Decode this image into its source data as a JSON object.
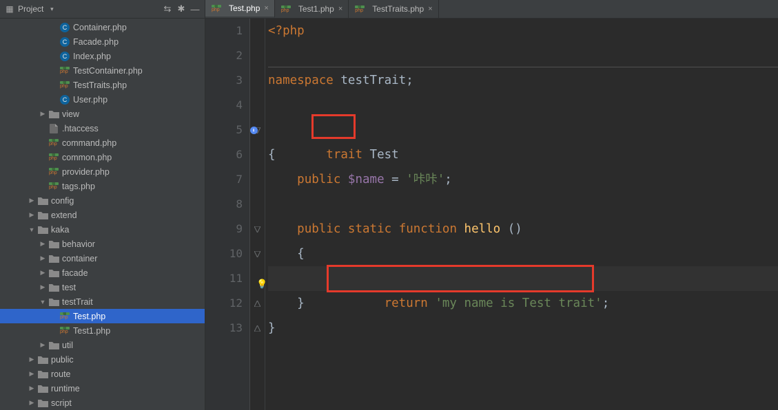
{
  "sidebar": {
    "title": "Project",
    "tree": [
      {
        "depth": 4,
        "icon": "php-class",
        "label": "Container.php",
        "arrow": "none"
      },
      {
        "depth": 4,
        "icon": "php-class",
        "label": "Facade.php",
        "arrow": "none"
      },
      {
        "depth": 4,
        "icon": "php-class",
        "label": "Index.php",
        "arrow": "none"
      },
      {
        "depth": 4,
        "icon": "php-ns",
        "label": "TestContainer.php",
        "arrow": "none"
      },
      {
        "depth": 4,
        "icon": "php-ns",
        "label": "TestTraits.php",
        "arrow": "none"
      },
      {
        "depth": 4,
        "icon": "php-class",
        "label": "User.php",
        "arrow": "none"
      },
      {
        "depth": 3,
        "icon": "folder",
        "label": "view",
        "arrow": "right"
      },
      {
        "depth": 3,
        "icon": "file",
        "label": ".htaccess",
        "arrow": "none"
      },
      {
        "depth": 3,
        "icon": "php-ns",
        "label": "command.php",
        "arrow": "none"
      },
      {
        "depth": 3,
        "icon": "php-ns",
        "label": "common.php",
        "arrow": "none"
      },
      {
        "depth": 3,
        "icon": "php-ns",
        "label": "provider.php",
        "arrow": "none"
      },
      {
        "depth": 3,
        "icon": "php-ns",
        "label": "tags.php",
        "arrow": "none"
      },
      {
        "depth": 2,
        "icon": "folder",
        "label": "config",
        "arrow": "right"
      },
      {
        "depth": 2,
        "icon": "folder",
        "label": "extend",
        "arrow": "right"
      },
      {
        "depth": 2,
        "icon": "folder",
        "label": "kaka",
        "arrow": "down"
      },
      {
        "depth": 3,
        "icon": "folder",
        "label": "behavior",
        "arrow": "right"
      },
      {
        "depth": 3,
        "icon": "folder",
        "label": "container",
        "arrow": "right"
      },
      {
        "depth": 3,
        "icon": "folder",
        "label": "facade",
        "arrow": "right"
      },
      {
        "depth": 3,
        "icon": "folder",
        "label": "test",
        "arrow": "right"
      },
      {
        "depth": 3,
        "icon": "folder",
        "label": "testTrait",
        "arrow": "down"
      },
      {
        "depth": 4,
        "icon": "php-ns",
        "label": "Test.php",
        "arrow": "none",
        "selected": true
      },
      {
        "depth": 4,
        "icon": "php-ns",
        "label": "Test1.php",
        "arrow": "none"
      },
      {
        "depth": 3,
        "icon": "folder",
        "label": "util",
        "arrow": "right"
      },
      {
        "depth": 2,
        "icon": "folder",
        "label": "public",
        "arrow": "right"
      },
      {
        "depth": 2,
        "icon": "folder",
        "label": "route",
        "arrow": "right"
      },
      {
        "depth": 2,
        "icon": "folder",
        "label": "runtime",
        "arrow": "right"
      },
      {
        "depth": 2,
        "icon": "folder",
        "label": "script",
        "arrow": "right"
      }
    ]
  },
  "tabs": [
    {
      "label": "Test.php",
      "active": true
    },
    {
      "label": "Test1.php",
      "active": false
    },
    {
      "label": "TestTraits.php",
      "active": false
    }
  ],
  "code_lines": [
    "1",
    "2",
    "3",
    "4",
    "5",
    "6",
    "7",
    "8",
    "9",
    "10",
    "11",
    "12",
    "13"
  ],
  "tokens": {
    "l1": {
      "a": "<?php"
    },
    "l3": {
      "a": "namespace",
      "b": "testTrait",
      "c": ";"
    },
    "l5": {
      "a": "trait",
      "b": "Test"
    },
    "l6": {
      "a": "{"
    },
    "l7": {
      "a": "public",
      "b": "$name",
      "c": " = ",
      "d": "'咔咔'",
      "e": ";"
    },
    "l9": {
      "a": "public",
      "b": "static",
      "c": "function",
      "d": "hello",
      "e": " ()"
    },
    "l10": {
      "a": "{"
    },
    "l11": {
      "a": "return",
      "b": "'my name is Test trait'",
      "c": ";"
    },
    "l12": {
      "a": "}"
    },
    "l13": {
      "a": "}"
    }
  }
}
